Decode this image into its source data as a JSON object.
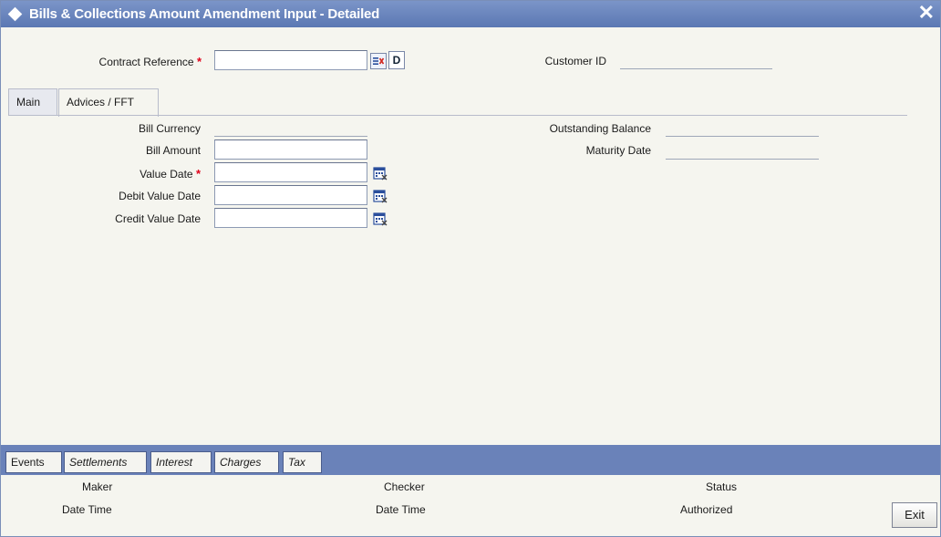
{
  "window": {
    "title": "Bills & Collections Amount Amendment Input - Detailed",
    "close_glyph": "✕"
  },
  "header": {
    "contract_reference_label": "Contract Reference",
    "contract_reference_value": "",
    "required_marker": "*",
    "d_button_label": "D",
    "customer_id_label": "Customer ID",
    "customer_id_value": ""
  },
  "tabs": [
    {
      "label": "Main",
      "active": false
    },
    {
      "label": "Advices / FFT",
      "active": true
    }
  ],
  "form": {
    "bill_currency_label": "Bill Currency",
    "bill_currency_value": "",
    "bill_amount_label": "Bill Amount",
    "bill_amount_value": "",
    "value_date_label": "Value Date",
    "value_date_value": "",
    "debit_value_date_label": "Debit Value Date",
    "debit_value_date_value": "",
    "credit_value_date_label": "Credit Value Date",
    "credit_value_date_value": "",
    "outstanding_balance_label": "Outstanding Balance",
    "outstanding_balance_value": "",
    "maturity_date_label": "Maturity Date",
    "maturity_date_value": ""
  },
  "subsystems": [
    {
      "label": "Events",
      "italic": false
    },
    {
      "label": "Settlements",
      "italic": true
    },
    {
      "label": "Interest",
      "italic": true
    },
    {
      "label": "Charges",
      "italic": true
    },
    {
      "label": "Tax",
      "italic": true
    }
  ],
  "audit": {
    "maker_label": "Maker",
    "maker_datetime_label": "Date Time",
    "checker_label": "Checker",
    "checker_datetime_label": "Date Time",
    "status_label": "Status",
    "status_value": "Authorized",
    "exit_label": "Exit"
  },
  "icons": {
    "window": "diamond-icon",
    "list": "list-of-values-icon",
    "calendar": "calendar-icon"
  },
  "colors": {
    "titlebar": "#6a86bf",
    "toolbar": "#6a82b9",
    "required": "#e0001a",
    "background": "#f5f5ef"
  }
}
